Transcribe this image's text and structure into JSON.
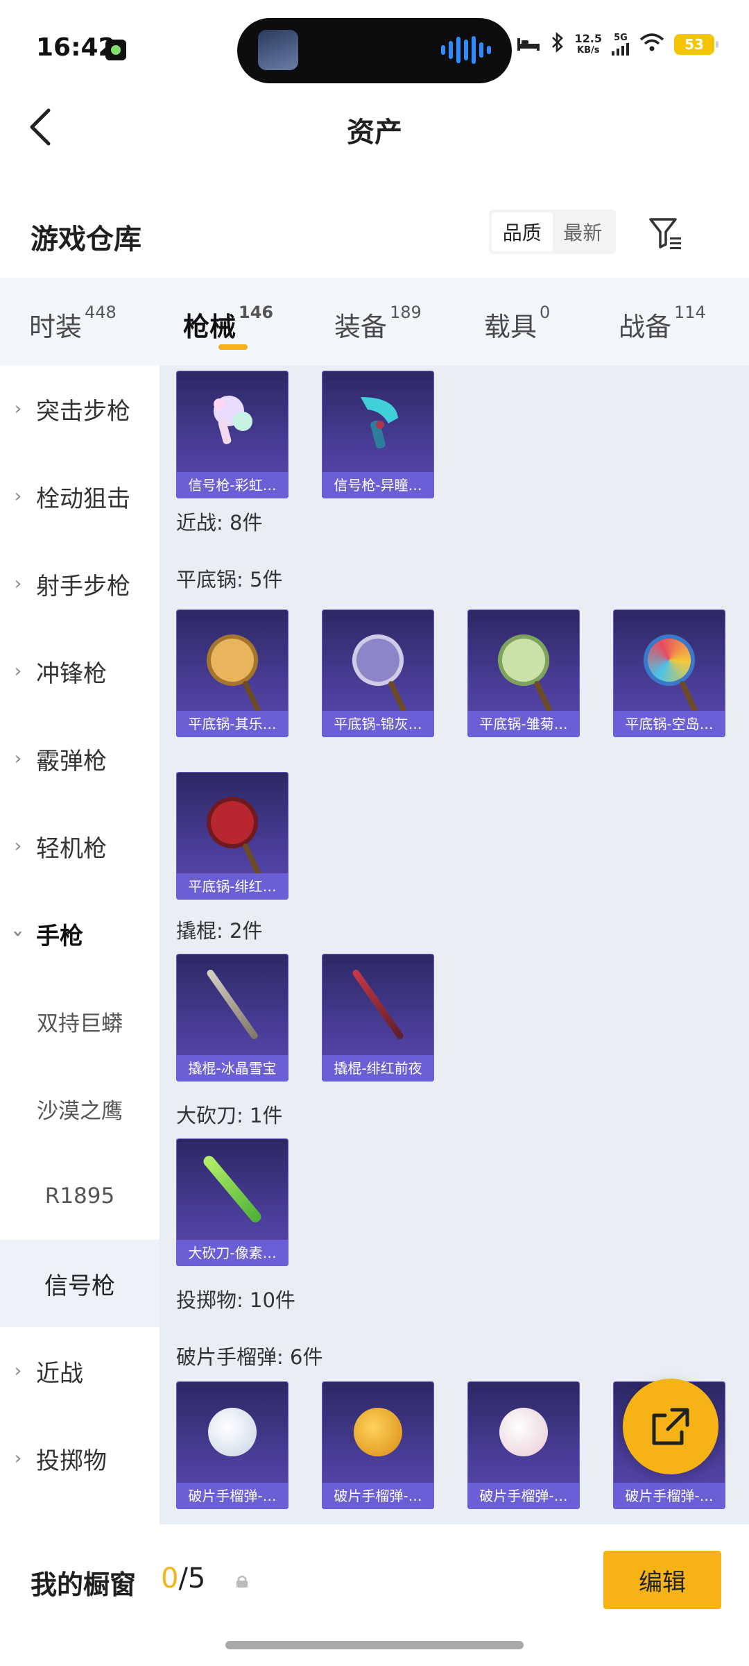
{
  "status_bar": {
    "time": "16:42",
    "net_speed_value": "12.5",
    "net_speed_unit": "KB/s",
    "network": "5G",
    "battery": "53"
  },
  "header": {
    "back_icon": "back-arrow-icon",
    "title": "资产"
  },
  "section": {
    "title": "游戏仓库",
    "sort_options": [
      "品质",
      "最新"
    ],
    "sort_selected": "品质",
    "filter_icon": "filter-icon"
  },
  "tabs": [
    {
      "label": "时装",
      "count": "448"
    },
    {
      "label": "枪械",
      "count": "146",
      "active": true
    },
    {
      "label": "装备",
      "count": "189"
    },
    {
      "label": "载具",
      "count": "0"
    },
    {
      "label": "战备",
      "count": "114"
    }
  ],
  "sidebar": [
    {
      "label": "突击步枪",
      "type": "category"
    },
    {
      "label": "栓动狙击",
      "type": "category"
    },
    {
      "label": "射手步枪",
      "type": "category"
    },
    {
      "label": "冲锋枪",
      "type": "category"
    },
    {
      "label": "霰弹枪",
      "type": "category"
    },
    {
      "label": "轻机枪",
      "type": "category"
    },
    {
      "label": "手枪",
      "type": "expanded"
    },
    {
      "label": "双持巨蟒",
      "type": "sub"
    },
    {
      "label": "沙漠之鹰",
      "type": "sub"
    },
    {
      "label": "R1895",
      "type": "sub"
    },
    {
      "label": "信号枪",
      "type": "selected"
    },
    {
      "label": "近战",
      "type": "category"
    },
    {
      "label": "投掷物",
      "type": "category"
    }
  ],
  "content": {
    "flare_items": [
      "信号枪-彩虹…",
      "信号枪-异瞳…"
    ],
    "melee_label": "近战: 8件",
    "pan_label": "平底锅: 5件",
    "pan_items": [
      "平底锅-其乐…",
      "平底锅-锦灰…",
      "平底锅-雏菊…",
      "平底锅-空岛…",
      "平底锅-绯红…"
    ],
    "crowbar_label": "撬棍: 2件",
    "crowbar_items": [
      "撬棍-冰晶雪宝",
      "撬棍-绯红前夜"
    ],
    "machete_label": "大砍刀: 1件",
    "machete_items": [
      "大砍刀-像素…"
    ],
    "throwable_label": "投掷物: 10件",
    "frag_label": "破片手榴弹: 6件",
    "frag_items": [
      "破片手榴弹-…",
      "破片手榴弹-…",
      "破片手榴弹-…",
      "破片手榴弹-…"
    ]
  },
  "fab_icon": "share-export-icon",
  "bottom_bar": {
    "title": "我的橱窗",
    "used": "0",
    "total": "/5",
    "lock_icon": "lock-icon",
    "edit_label": "编辑"
  },
  "colors": {
    "accent": "#f6b316",
    "card_bg": "#3a3380",
    "card_label": "#6b5fd6",
    "content_bg": "#e9edf4"
  }
}
